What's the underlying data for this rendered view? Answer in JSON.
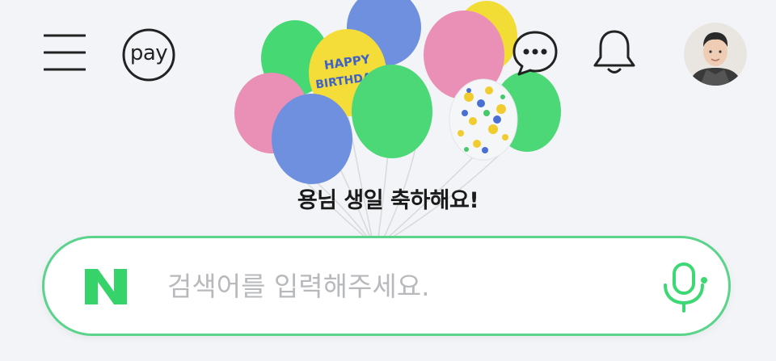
{
  "header": {
    "menu_icon": "hamburger-menu-icon",
    "pay_label": "pay",
    "chat_icon": "chat-bubble-icon",
    "bell_icon": "bell-icon",
    "avatar": "profile-avatar"
  },
  "doodle": {
    "balloon_text": "HAPPY BIRTHDAY",
    "message": "용님 생일 축하해요!"
  },
  "search": {
    "logo_icon": "naver-n-logo",
    "placeholder": "검색어를 입력해주세요.",
    "value": "",
    "mic_icon": "microphone-icon"
  },
  "colors": {
    "background": "#f2f4f7",
    "accent": "#59d48a",
    "logo_green": "#36d36a"
  }
}
